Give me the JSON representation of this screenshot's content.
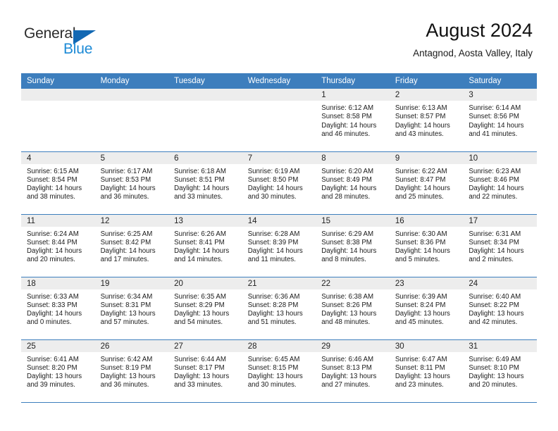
{
  "brand": {
    "name_part1": "General",
    "name_part2": "Blue",
    "triangle_color": "#1268b3",
    "blue_color": "#1c8ad6"
  },
  "header": {
    "title": "August 2024",
    "subtitle": "Antagnod, Aosta Valley, Italy"
  },
  "theme": {
    "header_row_color": "#3d7ebd",
    "daynum_bg": "#ededed",
    "row_border": "#3d7ebd"
  },
  "weekdays": [
    "Sunday",
    "Monday",
    "Tuesday",
    "Wednesday",
    "Thursday",
    "Friday",
    "Saturday"
  ],
  "weeks": [
    [
      {
        "day": "",
        "sunrise": "",
        "sunset": "",
        "daylight1": "",
        "daylight2": ""
      },
      {
        "day": "",
        "sunrise": "",
        "sunset": "",
        "daylight1": "",
        "daylight2": ""
      },
      {
        "day": "",
        "sunrise": "",
        "sunset": "",
        "daylight1": "",
        "daylight2": ""
      },
      {
        "day": "",
        "sunrise": "",
        "sunset": "",
        "daylight1": "",
        "daylight2": ""
      },
      {
        "day": "1",
        "sunrise": "Sunrise: 6:12 AM",
        "sunset": "Sunset: 8:58 PM",
        "daylight1": "Daylight: 14 hours",
        "daylight2": "and 46 minutes."
      },
      {
        "day": "2",
        "sunrise": "Sunrise: 6:13 AM",
        "sunset": "Sunset: 8:57 PM",
        "daylight1": "Daylight: 14 hours",
        "daylight2": "and 43 minutes."
      },
      {
        "day": "3",
        "sunrise": "Sunrise: 6:14 AM",
        "sunset": "Sunset: 8:56 PM",
        "daylight1": "Daylight: 14 hours",
        "daylight2": "and 41 minutes."
      }
    ],
    [
      {
        "day": "4",
        "sunrise": "Sunrise: 6:15 AM",
        "sunset": "Sunset: 8:54 PM",
        "daylight1": "Daylight: 14 hours",
        "daylight2": "and 38 minutes."
      },
      {
        "day": "5",
        "sunrise": "Sunrise: 6:17 AM",
        "sunset": "Sunset: 8:53 PM",
        "daylight1": "Daylight: 14 hours",
        "daylight2": "and 36 minutes."
      },
      {
        "day": "6",
        "sunrise": "Sunrise: 6:18 AM",
        "sunset": "Sunset: 8:51 PM",
        "daylight1": "Daylight: 14 hours",
        "daylight2": "and 33 minutes."
      },
      {
        "day": "7",
        "sunrise": "Sunrise: 6:19 AM",
        "sunset": "Sunset: 8:50 PM",
        "daylight1": "Daylight: 14 hours",
        "daylight2": "and 30 minutes."
      },
      {
        "day": "8",
        "sunrise": "Sunrise: 6:20 AM",
        "sunset": "Sunset: 8:49 PM",
        "daylight1": "Daylight: 14 hours",
        "daylight2": "and 28 minutes."
      },
      {
        "day": "9",
        "sunrise": "Sunrise: 6:22 AM",
        "sunset": "Sunset: 8:47 PM",
        "daylight1": "Daylight: 14 hours",
        "daylight2": "and 25 minutes."
      },
      {
        "day": "10",
        "sunrise": "Sunrise: 6:23 AM",
        "sunset": "Sunset: 8:46 PM",
        "daylight1": "Daylight: 14 hours",
        "daylight2": "and 22 minutes."
      }
    ],
    [
      {
        "day": "11",
        "sunrise": "Sunrise: 6:24 AM",
        "sunset": "Sunset: 8:44 PM",
        "daylight1": "Daylight: 14 hours",
        "daylight2": "and 20 minutes."
      },
      {
        "day": "12",
        "sunrise": "Sunrise: 6:25 AM",
        "sunset": "Sunset: 8:42 PM",
        "daylight1": "Daylight: 14 hours",
        "daylight2": "and 17 minutes."
      },
      {
        "day": "13",
        "sunrise": "Sunrise: 6:26 AM",
        "sunset": "Sunset: 8:41 PM",
        "daylight1": "Daylight: 14 hours",
        "daylight2": "and 14 minutes."
      },
      {
        "day": "14",
        "sunrise": "Sunrise: 6:28 AM",
        "sunset": "Sunset: 8:39 PM",
        "daylight1": "Daylight: 14 hours",
        "daylight2": "and 11 minutes."
      },
      {
        "day": "15",
        "sunrise": "Sunrise: 6:29 AM",
        "sunset": "Sunset: 8:38 PM",
        "daylight1": "Daylight: 14 hours",
        "daylight2": "and 8 minutes."
      },
      {
        "day": "16",
        "sunrise": "Sunrise: 6:30 AM",
        "sunset": "Sunset: 8:36 PM",
        "daylight1": "Daylight: 14 hours",
        "daylight2": "and 5 minutes."
      },
      {
        "day": "17",
        "sunrise": "Sunrise: 6:31 AM",
        "sunset": "Sunset: 8:34 PM",
        "daylight1": "Daylight: 14 hours",
        "daylight2": "and 2 minutes."
      }
    ],
    [
      {
        "day": "18",
        "sunrise": "Sunrise: 6:33 AM",
        "sunset": "Sunset: 8:33 PM",
        "daylight1": "Daylight: 14 hours",
        "daylight2": "and 0 minutes."
      },
      {
        "day": "19",
        "sunrise": "Sunrise: 6:34 AM",
        "sunset": "Sunset: 8:31 PM",
        "daylight1": "Daylight: 13 hours",
        "daylight2": "and 57 minutes."
      },
      {
        "day": "20",
        "sunrise": "Sunrise: 6:35 AM",
        "sunset": "Sunset: 8:29 PM",
        "daylight1": "Daylight: 13 hours",
        "daylight2": "and 54 minutes."
      },
      {
        "day": "21",
        "sunrise": "Sunrise: 6:36 AM",
        "sunset": "Sunset: 8:28 PM",
        "daylight1": "Daylight: 13 hours",
        "daylight2": "and 51 minutes."
      },
      {
        "day": "22",
        "sunrise": "Sunrise: 6:38 AM",
        "sunset": "Sunset: 8:26 PM",
        "daylight1": "Daylight: 13 hours",
        "daylight2": "and 48 minutes."
      },
      {
        "day": "23",
        "sunrise": "Sunrise: 6:39 AM",
        "sunset": "Sunset: 8:24 PM",
        "daylight1": "Daylight: 13 hours",
        "daylight2": "and 45 minutes."
      },
      {
        "day": "24",
        "sunrise": "Sunrise: 6:40 AM",
        "sunset": "Sunset: 8:22 PM",
        "daylight1": "Daylight: 13 hours",
        "daylight2": "and 42 minutes."
      }
    ],
    [
      {
        "day": "25",
        "sunrise": "Sunrise: 6:41 AM",
        "sunset": "Sunset: 8:20 PM",
        "daylight1": "Daylight: 13 hours",
        "daylight2": "and 39 minutes."
      },
      {
        "day": "26",
        "sunrise": "Sunrise: 6:42 AM",
        "sunset": "Sunset: 8:19 PM",
        "daylight1": "Daylight: 13 hours",
        "daylight2": "and 36 minutes."
      },
      {
        "day": "27",
        "sunrise": "Sunrise: 6:44 AM",
        "sunset": "Sunset: 8:17 PM",
        "daylight1": "Daylight: 13 hours",
        "daylight2": "and 33 minutes."
      },
      {
        "day": "28",
        "sunrise": "Sunrise: 6:45 AM",
        "sunset": "Sunset: 8:15 PM",
        "daylight1": "Daylight: 13 hours",
        "daylight2": "and 30 minutes."
      },
      {
        "day": "29",
        "sunrise": "Sunrise: 6:46 AM",
        "sunset": "Sunset: 8:13 PM",
        "daylight1": "Daylight: 13 hours",
        "daylight2": "and 27 minutes."
      },
      {
        "day": "30",
        "sunrise": "Sunrise: 6:47 AM",
        "sunset": "Sunset: 8:11 PM",
        "daylight1": "Daylight: 13 hours",
        "daylight2": "and 23 minutes."
      },
      {
        "day": "31",
        "sunrise": "Sunrise: 6:49 AM",
        "sunset": "Sunset: 8:10 PM",
        "daylight1": "Daylight: 13 hours",
        "daylight2": "and 20 minutes."
      }
    ]
  ]
}
